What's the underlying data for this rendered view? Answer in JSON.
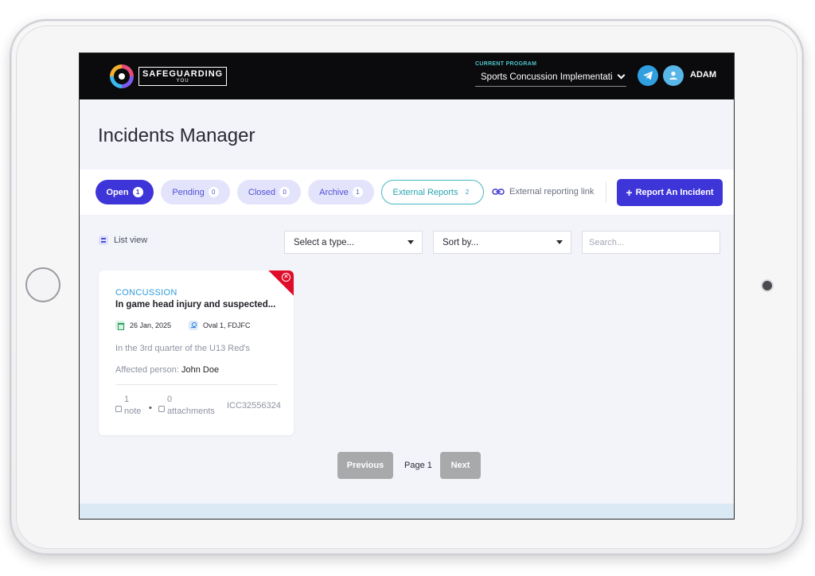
{
  "brand": {
    "name": "SAFEGUARDING",
    "sub": "YOU"
  },
  "header": {
    "program_label": "CURRENT PROGRAM",
    "program_value": "Sports Concussion Implementation",
    "user_name": "ADAM"
  },
  "page": {
    "title": "Incidents Manager"
  },
  "tabs": [
    {
      "label": "Open",
      "count": "1"
    },
    {
      "label": "Pending",
      "count": "0"
    },
    {
      "label": "Closed",
      "count": "0"
    },
    {
      "label": "Archive",
      "count": "1"
    },
    {
      "label": "External Reports",
      "count": "2"
    }
  ],
  "external_link_label": "External reporting link",
  "report_button": {
    "plus": "+",
    "label": "Report An Incident"
  },
  "filters": {
    "list_view_label": "List view",
    "type_select": "Select a type...",
    "sort_select": "Sort by...",
    "search_placeholder": "Search..."
  },
  "incident": {
    "category": "CONCUSSION",
    "title": "In game head injury and suspected...",
    "date": "26 Jan, 2025",
    "location": "Oval 1, FDJFC",
    "description": "In the 3rd quarter of the U13 Red's",
    "affected_label": "Affected person: ",
    "affected_name": "John Doe",
    "notes_count": "1",
    "notes_word": "note",
    "attachments_count": "0",
    "attachments_word": "attachments",
    "reference": "ICC32556324"
  },
  "pagination": {
    "previous": "Previous",
    "page_label": "Page 1",
    "next": "Next"
  },
  "colors": {
    "primary": "#3e35d8",
    "accent_teal": "#46b7c3",
    "alert_red": "#e00d2a",
    "category_blue": "#2f9bd8"
  }
}
